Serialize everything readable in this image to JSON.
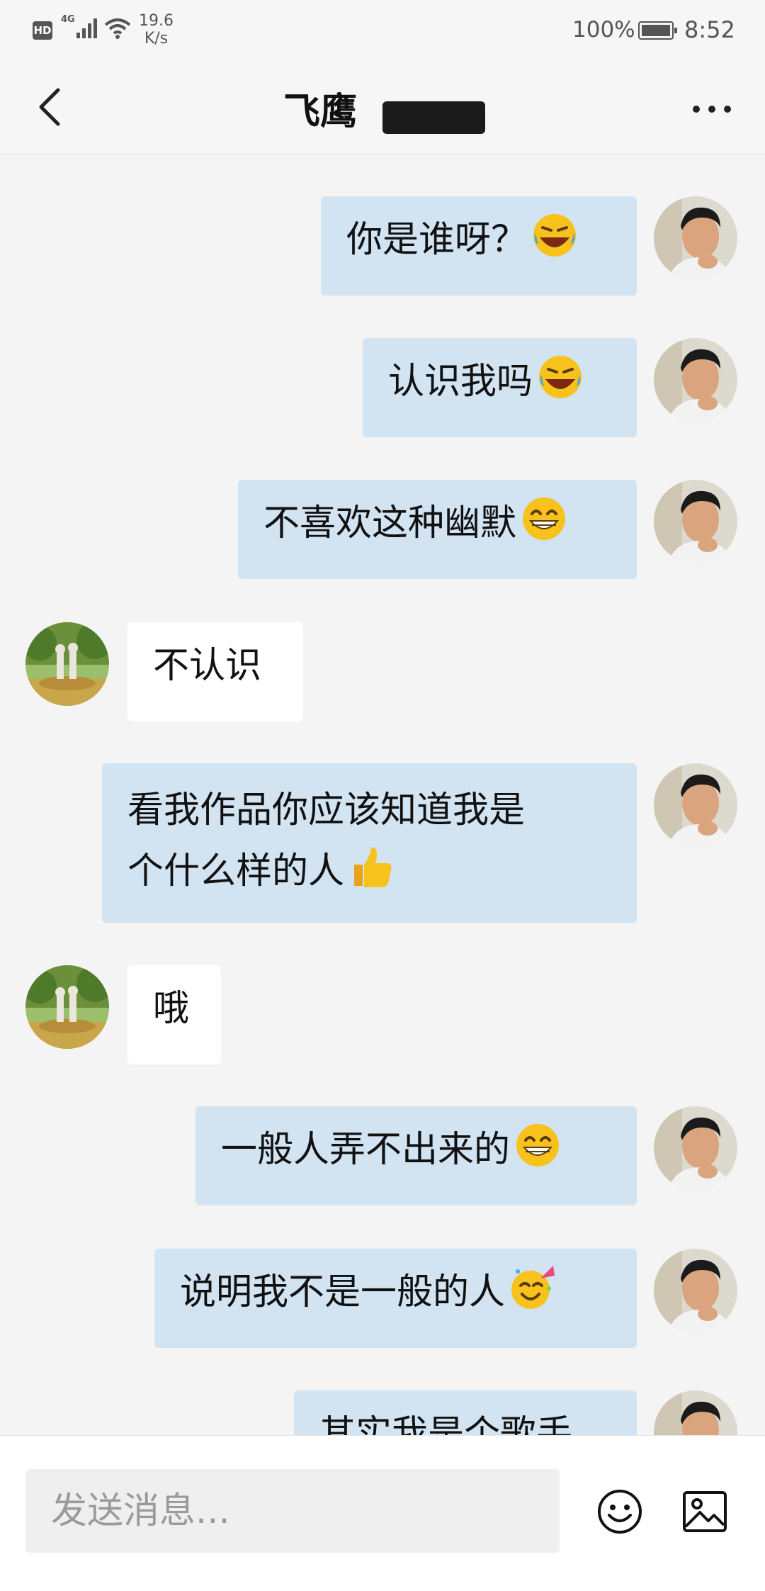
{
  "status_bar": {
    "hd": "HD",
    "network": "4G",
    "speed_value": "19.6",
    "speed_unit": "K/s",
    "battery": "100%",
    "time": "8:52"
  },
  "header": {
    "title": "飞鹰"
  },
  "messages": [
    {
      "side": "me",
      "text": "你是谁呀？",
      "emoji": "laughing-crying-emoji"
    },
    {
      "side": "me",
      "text": "认识我吗",
      "emoji": "laughing-crying-emoji"
    },
    {
      "side": "me",
      "text": "不喜欢这种幽默",
      "emoji": "grinning-emoji"
    },
    {
      "side": "them",
      "text": "不认识",
      "emoji": ""
    },
    {
      "side": "me",
      "text": "看我作品你应该知道我是",
      "text2": "个什么样的人",
      "emoji": "thumbs-up-emoji"
    },
    {
      "side": "them",
      "text": "哦",
      "emoji": ""
    },
    {
      "side": "me",
      "text": "一般人弄不出来的",
      "emoji": "grinning-emoji"
    },
    {
      "side": "me",
      "text": "说明我不是一般的人",
      "emoji": "party-emoji"
    },
    {
      "side": "me",
      "text": "其实我是个歌手",
      "emoji": ""
    }
  ],
  "composer": {
    "placeholder": "发送消息..."
  },
  "colors": {
    "my_bubble": "#d2e3f2",
    "their_bubble": "#ffffff",
    "background": "#f4f4f4"
  }
}
